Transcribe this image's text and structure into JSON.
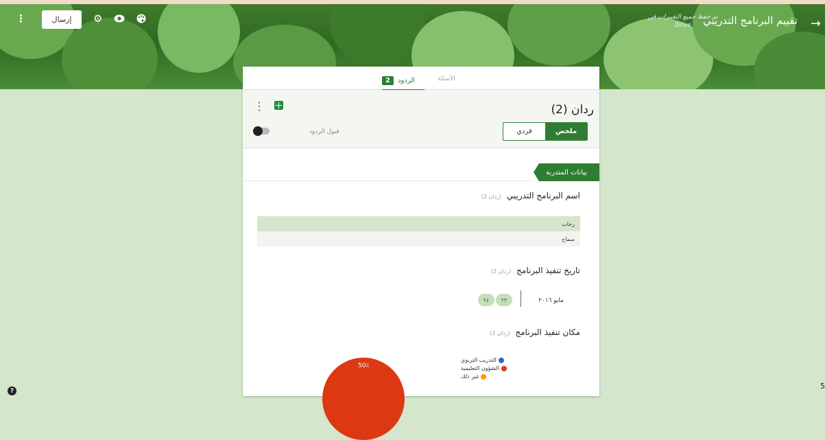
{
  "header": {
    "title": "تقييم البرنامج التدريبي",
    "saved_note_line1": "تم حفظ جميع التغييرات في",
    "saved_note_line2": "Drive",
    "send_label": "إرسال",
    "icons": [
      "more-vert-icon",
      "settings-icon",
      "preview-eye-icon",
      "palette-icon",
      "back-arrow-icon"
    ]
  },
  "tabs": {
    "questions_label": "الأسئلة",
    "responses_label": "الردود",
    "responses_count": "2"
  },
  "responses": {
    "count_title": "ردان (2)",
    "summary_label": "ملخص",
    "individual_label": "فردي",
    "accepting_label": "قبول الردود"
  },
  "section": {
    "title": "بيانات المتدربة"
  },
  "questions": [
    {
      "title": "اسم البرنامج التدريبي",
      "count": "(ردان 2)",
      "answers": [
        "رحاب",
        "سماح"
      ]
    },
    {
      "title": "تاريخ تنفيذ البرنامج",
      "count": "(ردان 2)",
      "month": "مايو ٢٠١٦",
      "days": [
        "٢٣",
        "٢٤"
      ]
    },
    {
      "title": "مكان تنفيذ البرنامج",
      "count": "(ردان 2)",
      "legend": [
        {
          "label": "التدريب التربوي",
          "color": "#3366cc"
        },
        {
          "label": "الشؤون التعليمية",
          "color": "#dc3912"
        },
        {
          "label": "غير ذلك",
          "color": "#ff9900"
        }
      ],
      "pie_label": "50٪"
    }
  ],
  "footer": {
    "help_label": "?",
    "edge_number": "5"
  }
}
